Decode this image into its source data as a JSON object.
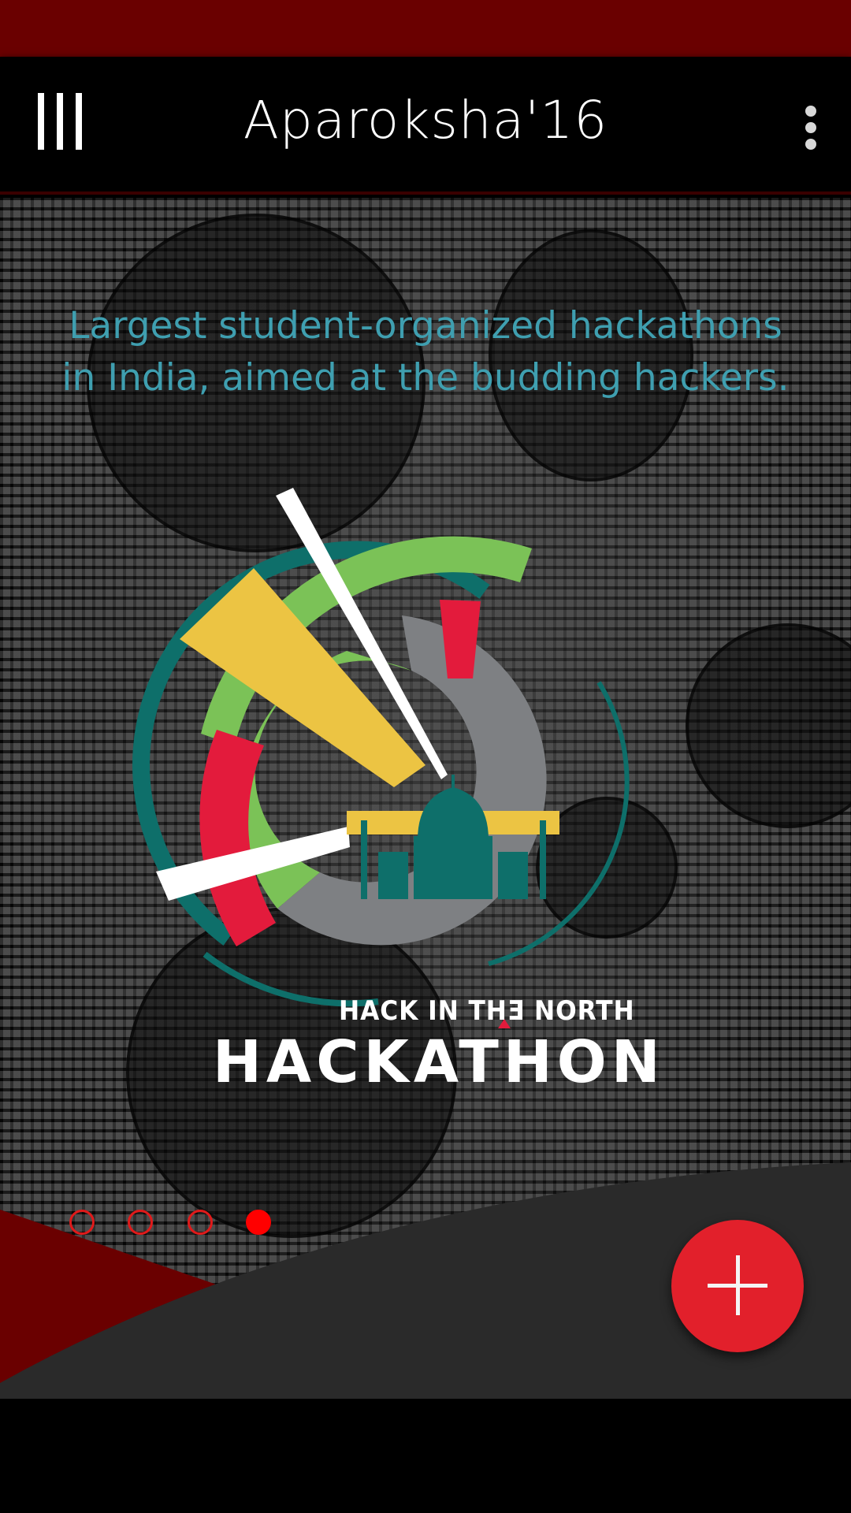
{
  "app_bar": {
    "title": "Aparoksha'16",
    "menu_icon": "hamburger-bars-icon",
    "overflow_icon": "more-vert-icon"
  },
  "slide": {
    "tagline": "Largest student-organized hackathons in India, aimed at the budding hackers.",
    "logo": {
      "subtitle": "HACK IN THƎ NORTH",
      "wordmark": "HACKATHON",
      "colors": {
        "red": "#e31b3c",
        "green": "#7bc257",
        "yellow": "#ecc443",
        "teal": "#0e6f6a",
        "gray": "#7e8083",
        "white": "#ffffff"
      }
    }
  },
  "pager": {
    "total": 4,
    "active_index": 3
  },
  "fab": {
    "icon": "plus-icon"
  },
  "colors": {
    "status_bar": "#6a0000",
    "accent_red": "#e2202b",
    "tagline": "#3f9fb0"
  }
}
